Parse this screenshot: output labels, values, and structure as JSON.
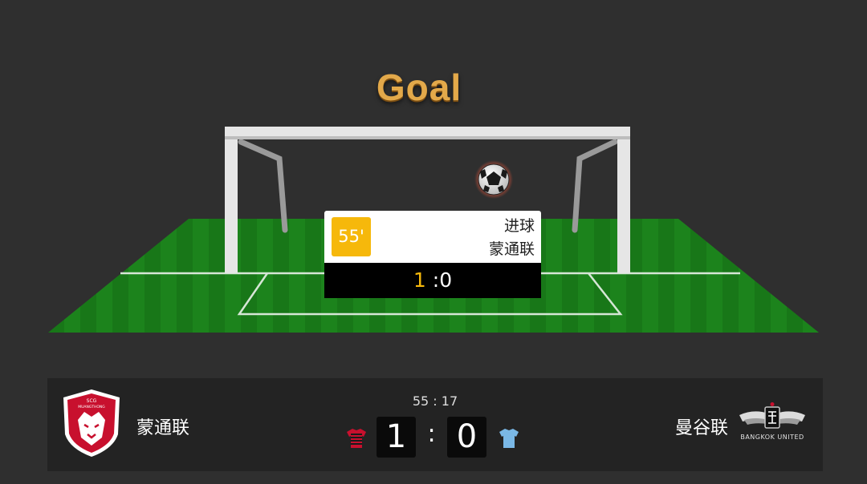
{
  "animation": {
    "title": "Goal"
  },
  "event_card": {
    "minute": "55'",
    "event_type": "进球",
    "team": "蒙通联",
    "score_home": "1",
    "score_sep": ":",
    "score_away": "0"
  },
  "scoreboard": {
    "clock": "55 : 17",
    "home": {
      "name": "蒙通联",
      "score": "1",
      "kit_color": "#c8102e",
      "logo_text": "SCG MUANGTHONG UNITED"
    },
    "away": {
      "name": "曼谷联",
      "score": "0",
      "kit_color": "#7ab8e6",
      "logo_text": "BANGKOK UNITED"
    },
    "separator": ":"
  },
  "colors": {
    "background": "#2f2f2f",
    "accent_gold": "#f6b80b",
    "pitch_green": "#1f8a1f",
    "scoreboard_bg": "#232323"
  }
}
